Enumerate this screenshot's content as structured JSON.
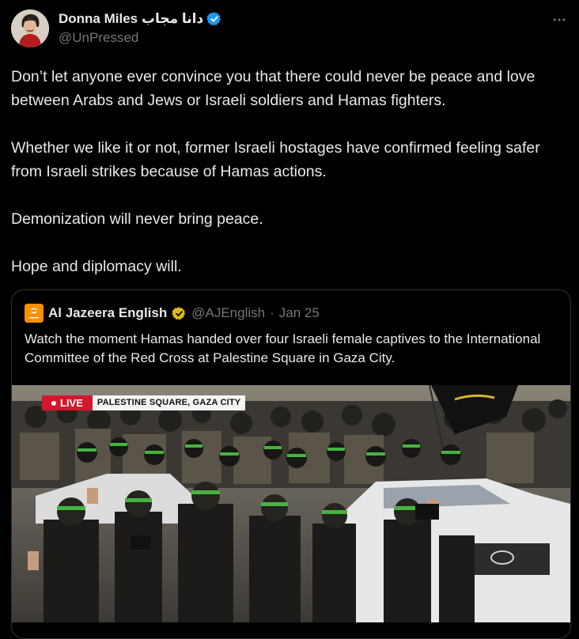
{
  "author": {
    "display_name": "Donna Miles دانا مجاب",
    "handle": "@UnPressed",
    "avatar_icon": "user-avatar",
    "verified_color": "#1d9bf0"
  },
  "more_icon": "more-horizontal-icon",
  "tweet": {
    "paragraphs": [
      "Don’t let anyone ever convince you that there could never be peace and love between Arabs and Jews or Israeli soldiers and Hamas fighters.",
      "Whether we like it or not, former Israeli hostages have confirmed feeling safer from Israeli strikes because of Hamas actions.",
      "Demonization will never bring peace.",
      "Hope and diplomacy will."
    ]
  },
  "quote": {
    "name": "Al Jazeera English",
    "handle": "@AJEnglish",
    "separator": "·",
    "date": "Jan 25",
    "text": "Watch the moment Hamas handed over four Israeli female captives to the International Committee of the Red Cross at Palestine Square in Gaza City.",
    "brand_color": "#fa9000",
    "verified_color": "#e2b719",
    "media": {
      "live_label": "LIVE",
      "location_label": "PALESTINE SQUARE, GAZA CITY"
    }
  }
}
